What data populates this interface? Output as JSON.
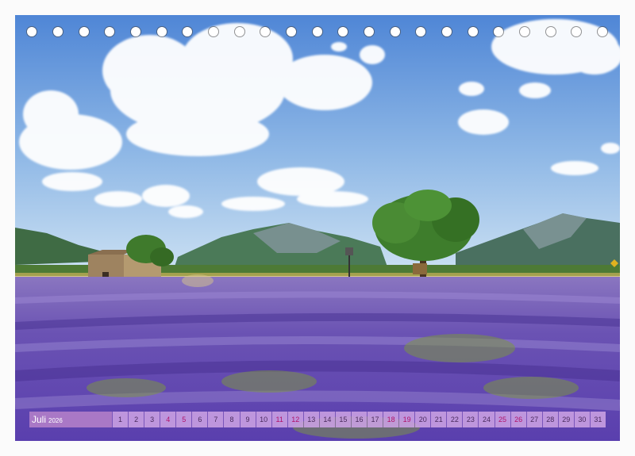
{
  "calendar": {
    "month": "Juli",
    "year": "2026",
    "days": [
      {
        "n": "1",
        "weekend": false
      },
      {
        "n": "2",
        "weekend": false
      },
      {
        "n": "3",
        "weekend": false
      },
      {
        "n": "4",
        "weekend": true
      },
      {
        "n": "5",
        "weekend": true
      },
      {
        "n": "6",
        "weekend": false
      },
      {
        "n": "7",
        "weekend": false
      },
      {
        "n": "8",
        "weekend": false
      },
      {
        "n": "9",
        "weekend": false
      },
      {
        "n": "10",
        "weekend": false
      },
      {
        "n": "11",
        "weekend": true
      },
      {
        "n": "12",
        "weekend": true
      },
      {
        "n": "13",
        "weekend": false
      },
      {
        "n": "14",
        "weekend": false
      },
      {
        "n": "15",
        "weekend": false
      },
      {
        "n": "16",
        "weekend": false
      },
      {
        "n": "17",
        "weekend": false
      },
      {
        "n": "18",
        "weekend": true
      },
      {
        "n": "19",
        "weekend": true
      },
      {
        "n": "20",
        "weekend": false
      },
      {
        "n": "21",
        "weekend": false
      },
      {
        "n": "22",
        "weekend": false
      },
      {
        "n": "23",
        "weekend": false
      },
      {
        "n": "24",
        "weekend": false
      },
      {
        "n": "25",
        "weekend": true
      },
      {
        "n": "26",
        "weekend": true
      },
      {
        "n": "27",
        "weekend": false
      },
      {
        "n": "28",
        "weekend": false
      },
      {
        "n": "29",
        "weekend": false
      },
      {
        "n": "30",
        "weekend": false
      },
      {
        "n": "31",
        "weekend": false
      }
    ]
  },
  "binding_rings": 23,
  "colors": {
    "weekend_text": "#b0126a",
    "weekday_text": "#4a2a5e",
    "month_label_bg": "#a978c6",
    "lavender": "#6b4fb0",
    "sky": "#5d8fd8"
  }
}
